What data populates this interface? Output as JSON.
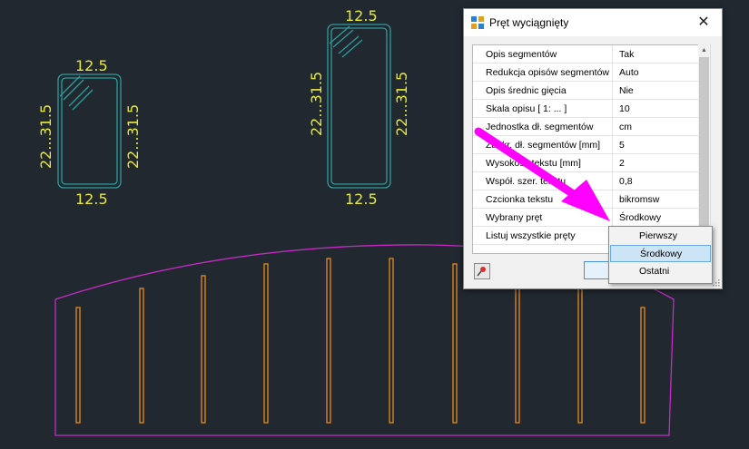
{
  "drawing": {
    "shape1": {
      "top": "12.5",
      "bottom": "12.5",
      "left": "22...31.5",
      "right": "22...31.5"
    },
    "shape2": {
      "top": "12.5",
      "bottom": "12.5",
      "left": "22...31.5",
      "right": "22...31.5"
    },
    "colors": {
      "outline": "#2e9c9c",
      "label": "#e6e83a",
      "envelope": "#c42bc4",
      "bars": "#e68a1e",
      "background": "#212830"
    }
  },
  "dialog": {
    "title": "Pręt wyciągnięty",
    "close_icon": "✕",
    "properties": [
      {
        "name": "Opis segmentów",
        "value": "Tak"
      },
      {
        "name": "Redukcja opisów segmentów",
        "value": "Auto"
      },
      {
        "name": "Opis średnic gięcia",
        "value": "Nie"
      },
      {
        "name": "Skala opisu [ 1: ... ]",
        "value": "10"
      },
      {
        "name": "Jednostka dł. segmentów",
        "value": "cm"
      },
      {
        "name": "Zaokr. dł. segmentów [mm]",
        "value": "5"
      },
      {
        "name": "Wysokość tekstu [mm]",
        "value": "2"
      },
      {
        "name": "Współ. szer. tekstu",
        "value": "0,8"
      },
      {
        "name": "Czcionka tekstu",
        "value": "bikromsw"
      },
      {
        "name": "Wybrany pręt",
        "value": "Środkowy"
      },
      {
        "name": "Listuj wszystkie pręty",
        "value": ""
      }
    ],
    "ok_label": ""
  },
  "dropdown": {
    "options": [
      "Pierwszy",
      "Środkowy",
      "Ostatni"
    ],
    "selected": "Środkowy"
  },
  "annotation": {
    "arrow_color": "#ff00ff"
  }
}
